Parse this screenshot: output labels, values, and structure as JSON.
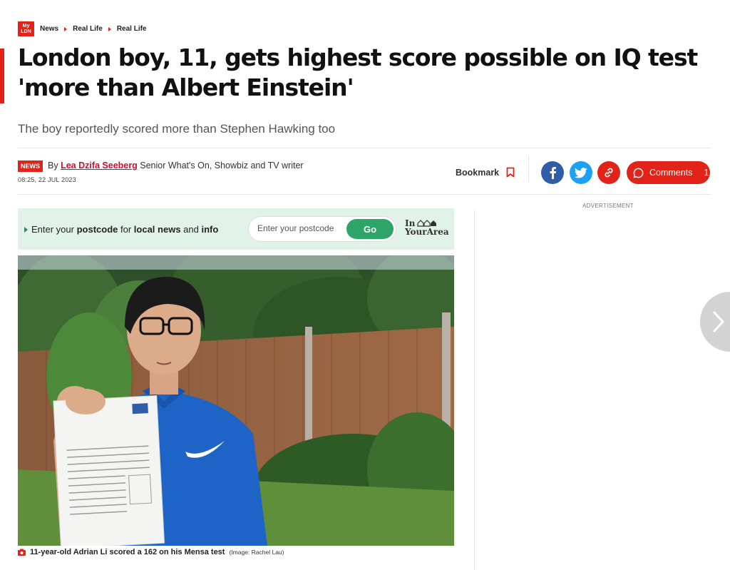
{
  "breadcrumb": {
    "logo_line1": "My",
    "logo_line2": "LDN",
    "items": [
      "News",
      "Real Life",
      "Real Life"
    ]
  },
  "article": {
    "headline": "London boy, 11, gets highest score possible on IQ test 'more than Albert Einstein'",
    "subtitle": "The boy reportedly scored more than Stephen Hawking too",
    "badge": "NEWS",
    "by": "By",
    "author": "Lea Dzifa Seeberg",
    "author_role": "Senior What's On, Showbiz and TV writer",
    "dateline": "08:25, 22 JUL 2023"
  },
  "actions": {
    "bookmark_label": "Bookmark",
    "comments_label": "Comments",
    "comments_count": "1"
  },
  "postcode": {
    "text_1": "Enter your ",
    "text_bold_1": "postcode",
    "text_2": " for ",
    "text_bold_2": "local news",
    "text_3": " and ",
    "text_bold_3": "info",
    "placeholder": "Enter your postcode",
    "go_label": "Go",
    "brand_line1": "In",
    "brand_line2": "YourArea"
  },
  "ad": {
    "label": "ADVERTISEMENT"
  },
  "image": {
    "caption": "11-year-old Adrian Li scored a 162 on his Mensa test",
    "credit": "(Image: Rachel Lau)",
    "letter_brand": "Mensa",
    "letter_heading": "Congratulations",
    "shirt_logo": "NIKE"
  },
  "colors": {
    "brand_red": "#e2231a",
    "facebook": "#2f5da8",
    "twitter": "#1da1f2",
    "go_green": "#2ea36a",
    "postcode_bg": "#e1f2e8"
  }
}
